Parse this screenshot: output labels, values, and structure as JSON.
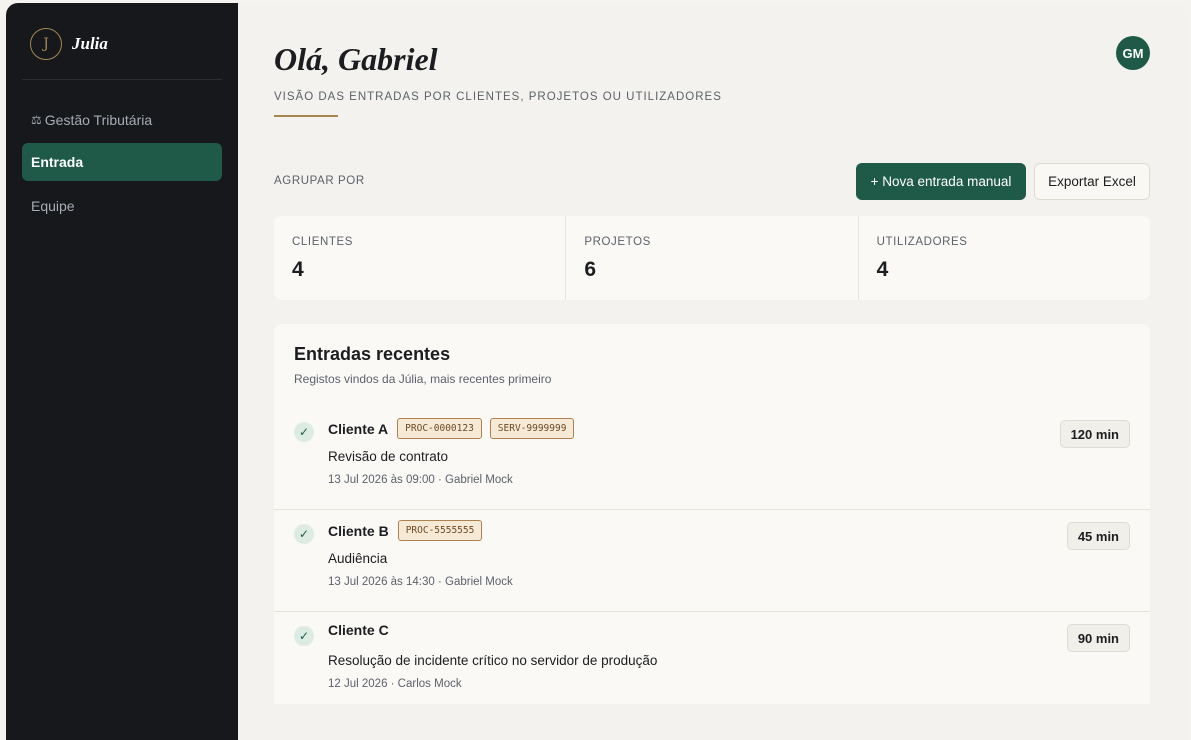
{
  "brand": {
    "logo_letter": "J",
    "name": "Julia"
  },
  "sidebar": {
    "items": [
      {
        "label": "Gestão Tributária",
        "icon": "scale-icon",
        "icon_glyph": "⚖",
        "active": false
      },
      {
        "label": "Entrada",
        "active": true
      },
      {
        "label": "Equipe",
        "active": false
      }
    ]
  },
  "header": {
    "greeting": "Olá, Gabriel",
    "subtitle": "Visão das entradas por clientes, projetos ou utilizadores",
    "avatar_initials": "GM"
  },
  "toolbar": {
    "group_label": "Agrupar por",
    "new_entry_label": "+ Nova entrada manual",
    "export_label": "Exportar Excel"
  },
  "stats": [
    {
      "label": "Clientes",
      "value": "4"
    },
    {
      "label": "Projetos",
      "value": "6"
    },
    {
      "label": "Utilizadores",
      "value": "4"
    }
  ],
  "recent": {
    "title": "Entradas recentes",
    "subtitle": "Registos vindos da Júlia, mais recentes primeiro",
    "entries": [
      {
        "client": "Cliente A",
        "tags": [
          "PROC-0000123",
          "SERV-9999999"
        ],
        "description": "Revisão de contrato",
        "meta": "13 Jul 2026 às 09:00 · Gabriel Mock",
        "duration": "120 min"
      },
      {
        "client": "Cliente B",
        "tags": [
          "PROC-5555555"
        ],
        "description": "Audiência",
        "meta": "13 Jul 2026 às 14:30 · Gabriel Mock",
        "duration": "45 min"
      },
      {
        "client": "Cliente C",
        "tags": [],
        "description": "Resolução de incidente crítico no servidor de produção",
        "meta": "12 Jul 2026 · Carlos Mock",
        "duration": "90 min"
      }
    ]
  },
  "colors": {
    "sidebar_bg": "#16181c",
    "accent_green": "#1e5a47",
    "accent_gold": "#a68650",
    "page_bg": "#f3f2ee",
    "card_bg": "#faf9f6"
  }
}
